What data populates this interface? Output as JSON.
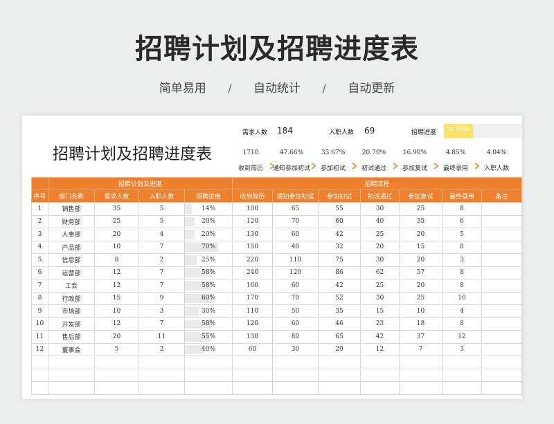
{
  "page": {
    "title": "招聘计划及招聘进度表",
    "taglines": [
      "简单易用",
      "自动统计",
      "自动更新"
    ],
    "separator": "/"
  },
  "sheet": {
    "title": "招聘计划及招聘进度表",
    "summary": {
      "demand_label": "需求人数",
      "demand_value": "184",
      "hired_label": "入职人数",
      "hired_value": "69",
      "progress_label": "招聘进度",
      "progress_text": "37.50%",
      "progress_fraction": 0.375
    },
    "funnel": {
      "values": [
        "1710",
        "47.66%",
        "35.67%",
        "20.70%",
        "16.90%",
        "4.85%",
        "4.04%"
      ],
      "labels": [
        "收到简历",
        "通知参加初试",
        "参加初试",
        "初试通过",
        "参加复试",
        "最终录用",
        "入职人数"
      ]
    },
    "colors": {
      "header": "#ed7f2d",
      "overall_bar": "#fde26a",
      "row_bar": "#e9e9e9"
    },
    "table": {
      "group_headers": [
        "招聘计划及进度",
        "招聘流程"
      ],
      "columns": [
        "序号",
        "部门名称",
        "需求人数",
        "入职人数",
        "招聘进度",
        "收到简历",
        "通知参加初试",
        "参加初试",
        "初试通过",
        "参加复试",
        "最终录用",
        "备注"
      ],
      "rows": [
        [
          "1",
          "销售部",
          "35",
          "5",
          "14%",
          "100",
          "65",
          "55",
          "30",
          "25",
          "8",
          ""
        ],
        [
          "2",
          "财务部",
          "25",
          "5",
          "20%",
          "120",
          "70",
          "60",
          "40",
          "35",
          "6",
          ""
        ],
        [
          "3",
          "人事部",
          "20",
          "4",
          "20%",
          "130",
          "60",
          "42",
          "25",
          "20",
          "5",
          ""
        ],
        [
          "4",
          "产品部",
          "10",
          "7",
          "70%",
          "150",
          "40",
          "32",
          "20",
          "15",
          "8",
          ""
        ],
        [
          "5",
          "信息部",
          "8",
          "2",
          "25%",
          "220",
          "110",
          "75",
          "30",
          "20",
          "3",
          ""
        ],
        [
          "6",
          "运营部",
          "12",
          "7",
          "58%",
          "240",
          "120",
          "86",
          "62",
          "57",
          "8",
          ""
        ],
        [
          "7",
          "工会",
          "12",
          "7",
          "58%",
          "160",
          "60",
          "42",
          "25",
          "20",
          "8",
          ""
        ],
        [
          "8",
          "行政部",
          "15",
          "9",
          "60%",
          "170",
          "70",
          "52",
          "30",
          "25",
          "10",
          ""
        ],
        [
          "9",
          "市场部",
          "10",
          "3",
          "30%",
          "110",
          "50",
          "35",
          "15",
          "10",
          "4",
          ""
        ],
        [
          "10",
          "开发部",
          "12",
          "7",
          "58%",
          "120",
          "60",
          "46",
          "23",
          "18",
          "8",
          ""
        ],
        [
          "11",
          "售后部",
          "20",
          "11",
          "55%",
          "130",
          "80",
          "65",
          "42",
          "37",
          "12",
          ""
        ],
        [
          "12",
          "董事会",
          "5",
          "2",
          "40%",
          "60",
          "30",
          "20",
          "12",
          "7",
          "3",
          ""
        ]
      ],
      "row_progress": [
        0.14,
        0.2,
        0.2,
        0.7,
        0.25,
        0.58,
        0.58,
        0.6,
        0.3,
        0.58,
        0.55,
        0.4
      ],
      "empty_rows": 3
    }
  }
}
